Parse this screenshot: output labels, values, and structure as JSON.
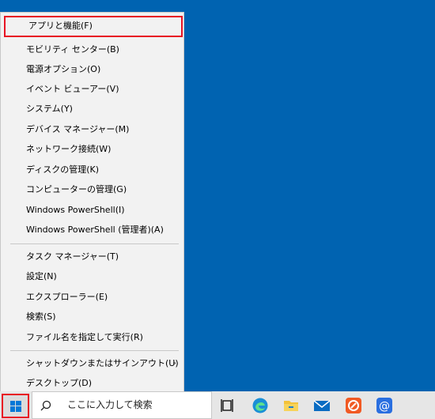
{
  "menu": {
    "items": [
      {
        "label": "アプリと機能(F)"
      },
      {
        "label": "モビリティ センター(B)"
      },
      {
        "label": "電源オプション(O)"
      },
      {
        "label": "イベント ビューアー(V)"
      },
      {
        "label": "システム(Y)"
      },
      {
        "label": "デバイス マネージャー(M)"
      },
      {
        "label": "ネットワーク接続(W)"
      },
      {
        "label": "ディスクの管理(K)"
      },
      {
        "label": "コンピューターの管理(G)"
      },
      {
        "label": "Windows PowerShell(I)"
      },
      {
        "label": "Windows PowerShell (管理者)(A)"
      },
      {
        "label": "タスク マネージャー(T)"
      },
      {
        "label": "設定(N)"
      },
      {
        "label": "エクスプローラー(E)"
      },
      {
        "label": "検索(S)"
      },
      {
        "label": "ファイル名を指定して実行(R)"
      },
      {
        "label": "シャットダウンまたはサインアウト(U)"
      },
      {
        "label": "デスクトップ(D)"
      }
    ],
    "submenu_chevron": "›"
  },
  "taskbar": {
    "search_placeholder": "ここに入力して検索",
    "icons": [
      "task-view-icon",
      "edge-icon",
      "file-explorer-icon",
      "mail-icon",
      "app-orange-icon",
      "at-mail-icon"
    ]
  },
  "colors": {
    "desktop": "#0063b1",
    "highlight": "#e81123"
  }
}
